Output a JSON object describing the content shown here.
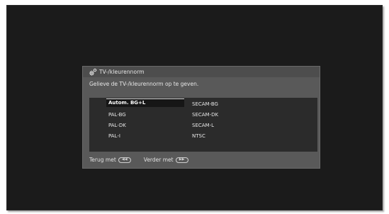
{
  "dialog": {
    "title": "TV-/kleurennorm",
    "prompt": "Gelieve de TV-/kleurennorm op te geven.",
    "title_icon": "gears-icon"
  },
  "options": {
    "left": [
      "Autom. BG+L",
      "PAL-BG",
      "PAL-DK",
      "PAL-I"
    ],
    "right": [
      "SECAM-BG",
      "SECAM-DK",
      "SECAM-L",
      "NTSC"
    ],
    "selected": "Autom. BG+L"
  },
  "footer": {
    "back_label": "Terug met",
    "back_key_icon": "rewind-key-icon",
    "next_label": "Verder met",
    "next_key_icon": "forward-key-icon"
  },
  "colors": {
    "screen_bg": "#1b1b1b",
    "dialog_bg": "#595959",
    "list_bg": "#2b2b2b",
    "selection_bg": "#161616"
  }
}
